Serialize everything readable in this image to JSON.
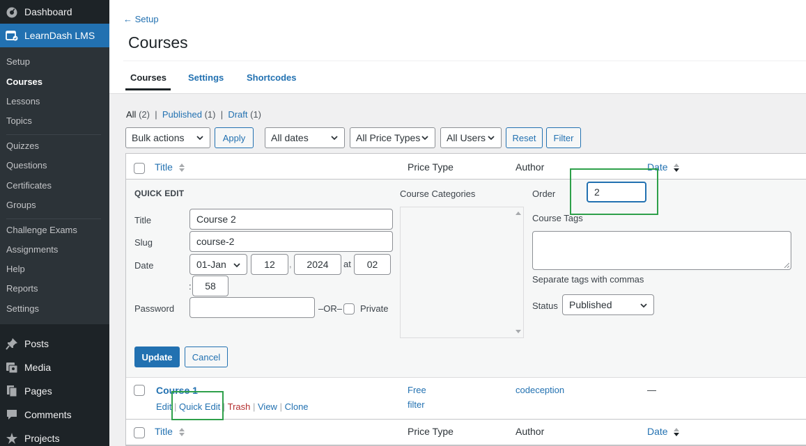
{
  "sidebar": {
    "dashboard": "Dashboard",
    "learndash": "LearnDash LMS",
    "submenu": [
      "Setup",
      "Courses",
      "Lessons",
      "Topics",
      "Quizzes",
      "Questions",
      "Certificates",
      "Groups",
      "Challenge Exams",
      "Assignments",
      "Help",
      "Reports",
      "Settings"
    ],
    "posts": "Posts",
    "media": "Media",
    "pages": "Pages",
    "comments": "Comments",
    "projects": "Projects"
  },
  "header": {
    "back": "← Setup",
    "title": "Courses",
    "tabs": [
      "Courses",
      "Settings",
      "Shortcodes"
    ]
  },
  "views": {
    "all": "All",
    "all_count": "(2)",
    "published": "Published",
    "published_count": "(1)",
    "draft": "Draft",
    "draft_count": "(1)",
    "sep": "|"
  },
  "filters": {
    "bulk": "Bulk actions",
    "apply": "Apply",
    "dates": "All dates",
    "price_types": "All Price Types",
    "users": "All Users",
    "reset": "Reset",
    "filter": "Filter"
  },
  "columns": {
    "title": "Title",
    "price_type": "Price Type",
    "author": "Author",
    "date": "Date"
  },
  "quick_edit": {
    "heading": "QUICK EDIT",
    "title_label": "Title",
    "title_value": "Course 2",
    "slug_label": "Slug",
    "slug_value": "course-2",
    "date_label": "Date",
    "month": "01-Jan",
    "day": "12",
    "comma": ",",
    "year": "2024",
    "at": "at",
    "hour": "02",
    "colon": ":",
    "minute": "58",
    "password_label": "Password",
    "or": "–OR–",
    "private": "Private",
    "categories_label": "Course Categories",
    "order_label": "Order",
    "order_value": "2",
    "tags_label": "Course Tags",
    "tags_hint": "Separate tags with commas",
    "status_label": "Status",
    "status_value": "Published",
    "update": "Update",
    "cancel": "Cancel"
  },
  "course_row": {
    "title": "Course 1",
    "actions": {
      "edit": "Edit",
      "quick_edit": "Quick Edit",
      "trash": "Trash",
      "view": "View",
      "clone": "Clone"
    },
    "price_line1": "Free",
    "price_line2": "filter",
    "author": "codeception",
    "date": "—"
  },
  "colors": {
    "sidebar_bg": "#1d2327",
    "accent": "#2271b1",
    "highlight": "#2ea04a"
  }
}
